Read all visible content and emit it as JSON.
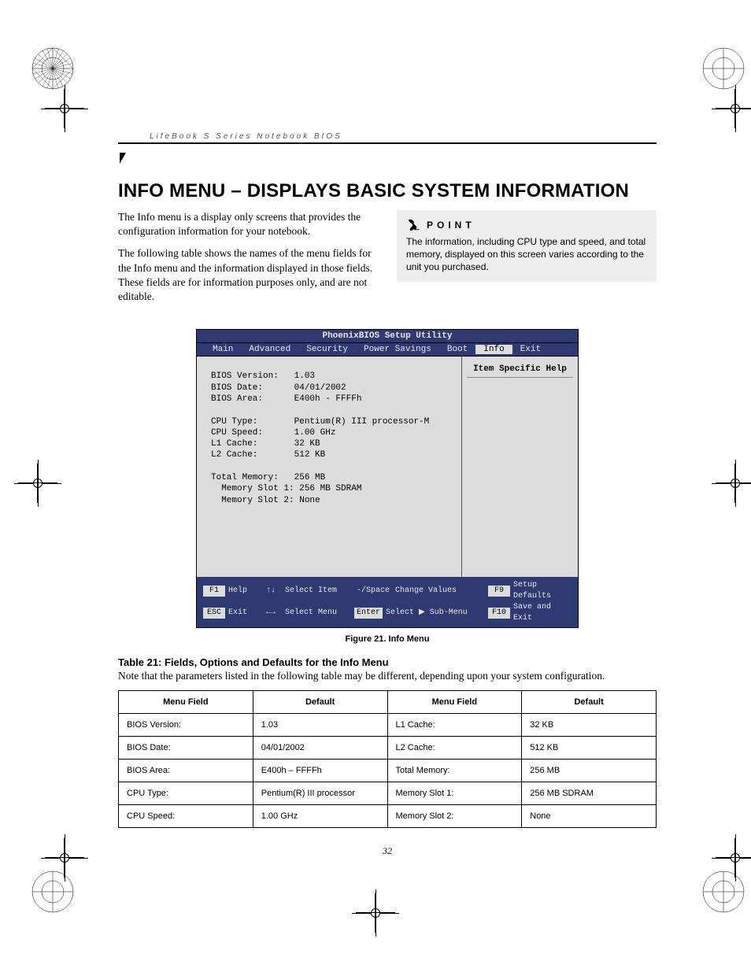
{
  "running_head": "LifeBook S Series Notebook BIOS",
  "heading": "INFO MENU – DISPLAYS BASIC SYSTEM INFORMATION",
  "intro_p1": "The Info menu is a display only screens that provides the configuration information for your notebook.",
  "intro_p2": "The following table shows the names of the menu fields for the Info menu and the information displayed in those fields. These fields are for information purposes only, and are not editable.",
  "point": {
    "label": "POINT",
    "body": "The information, including CPU type and speed, and total memory, displayed on this screen varies according to the unit you purchased."
  },
  "bios": {
    "title": "PhoenixBIOS Setup Utility",
    "tabs": [
      "Main",
      "Advanced",
      "Security",
      "Power Savings",
      "Boot",
      "Info",
      "Exit"
    ],
    "active_tab": "Info",
    "help_head": "Item Specific Help",
    "left_text": "BIOS Version:   1.03\nBIOS Date:      04/01/2002\nBIOS Area:      E400h - FFFFh\n\nCPU Type:       Pentium(R) III processor-M\nCPU Speed:      1.00 GHz\nL1 Cache:       32 KB\nL2 Cache:       512 KB\n\nTotal Memory:   256 MB\n  Memory Slot 1: 256 MB SDRAM\n  Memory Slot 2: None",
    "foot": {
      "r1c1k": "F1",
      "r1c1": "Help",
      "r1c2k": "↑↓",
      "r1c2": "Select Item",
      "r1c3k": "-/Space",
      "r1c3": "Change Values",
      "r1c4k": "F9",
      "r1c4": "Setup Defaults",
      "r2c1k": "ESC",
      "r2c1": "Exit",
      "r2c2k": "←→",
      "r2c2": "Select Menu",
      "r2c3k": "Enter",
      "r2c3": "Select ▶ Sub-Menu",
      "r2c4k": "F10",
      "r2c4": "Save and Exit"
    }
  },
  "fig_caption": "Figure 21.   Info Menu",
  "tbl_title": "Table 21: Fields, Options and Defaults for the Info Menu",
  "tbl_note": "Note that the parameters listed in the following table may be different, depending upon your system configuration.",
  "tbl_head": {
    "f": "Menu Field",
    "d": "Default"
  },
  "tbl_rows": [
    {
      "f1": "BIOS Version:",
      "d1": "1.03",
      "f2": "L1 Cache:",
      "d2": "32 KB"
    },
    {
      "f1": "BIOS Date:",
      "d1": "04/01/2002",
      "f2": "L2 Cache:",
      "d2": "512 KB"
    },
    {
      "f1": "BIOS Area:",
      "d1": "E400h – FFFFh",
      "f2": "Total Memory:",
      "d2": "256 MB"
    },
    {
      "f1": "CPU Type:",
      "d1": "Pentium(R) III processor",
      "f2": "Memory Slot 1:",
      "d2": "256 MB SDRAM"
    },
    {
      "f1": "CPU Speed:",
      "d1": "1.00 GHz",
      "f2": "Memory Slot 2:",
      "d2": "None"
    }
  ],
  "page_num": "32"
}
